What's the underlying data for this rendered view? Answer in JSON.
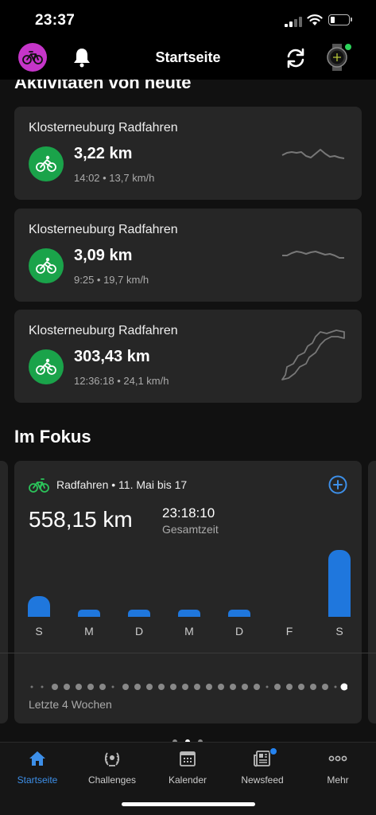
{
  "status_bar": {
    "time": "23:37"
  },
  "header": {
    "title": "Startseite"
  },
  "today": {
    "heading": "Aktivitäten von heute",
    "activities": [
      {
        "title": "Klosterneuburg Radfahren",
        "distance": "3,22 km",
        "meta": "14:02 • 13,7 km/h"
      },
      {
        "title": "Klosterneuburg Radfahren",
        "distance": "3,09 km",
        "meta": "9:25 • 19,7 km/h"
      },
      {
        "title": "Klosterneuburg Radfahren",
        "distance": "303,43 km",
        "meta": "12:36:18 • 24,1 km/h"
      }
    ]
  },
  "focus": {
    "heading": "Im Fokus",
    "label": "Radfahren • 11. Mai bis 17",
    "total_distance": "558,15 km",
    "total_time": "23:18:10",
    "total_time_label": "Gesamtzeit",
    "footer": "Letzte 4 Wochen",
    "accent_color": "#1f77dd"
  },
  "chart_data": {
    "type": "bar",
    "categories": [
      "S",
      "M",
      "D",
      "M",
      "D",
      "F",
      "S"
    ],
    "values": [
      93,
      28,
      28,
      28,
      28,
      0,
      303
    ],
    "unit": "km"
  },
  "tabs": [
    {
      "label": "Startseite",
      "icon": "home-icon",
      "active": true
    },
    {
      "label": "Challenges",
      "icon": "laurel-icon",
      "active": false
    },
    {
      "label": "Kalender",
      "icon": "calendar-icon",
      "active": false
    },
    {
      "label": "Newsfeed",
      "icon": "newspaper-icon",
      "active": false
    },
    {
      "label": "Mehr",
      "icon": "more-icon",
      "active": false
    }
  ]
}
